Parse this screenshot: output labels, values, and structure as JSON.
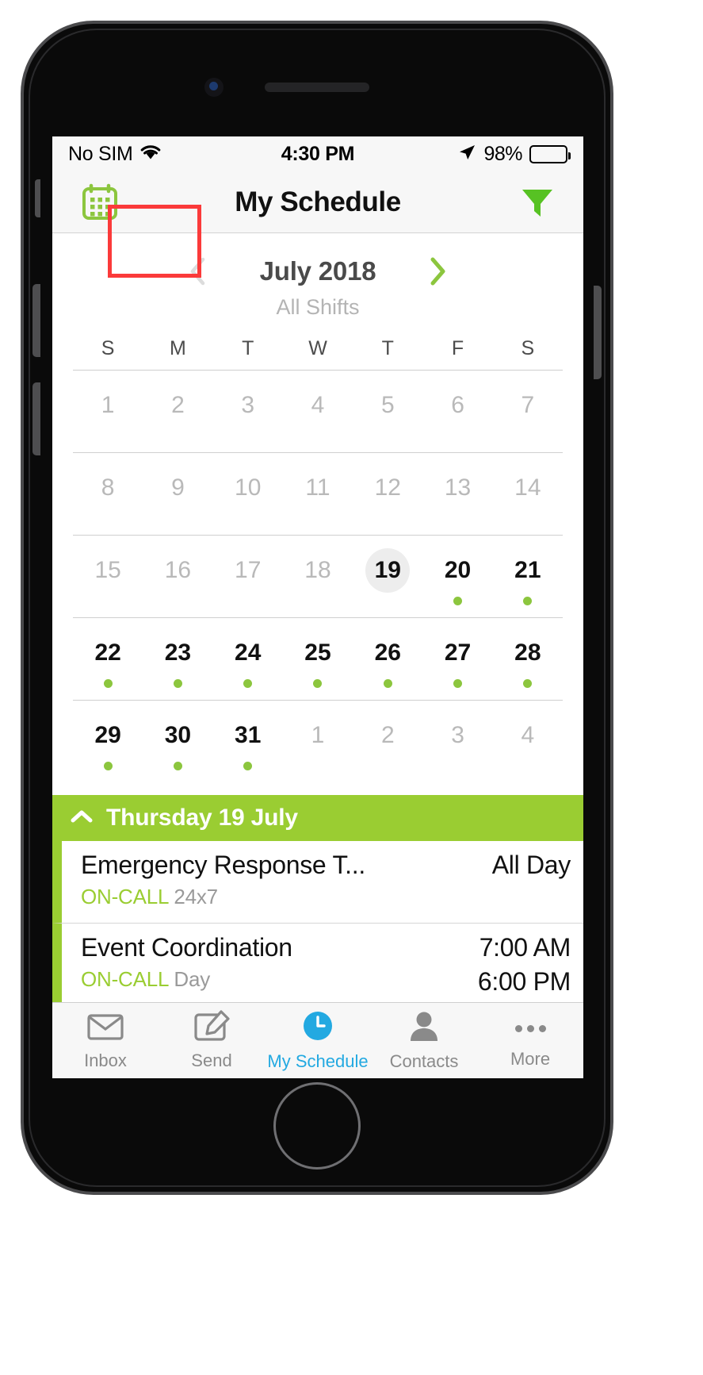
{
  "status_bar": {
    "carrier": "No SIM",
    "wifi_icon": "wifi-icon",
    "time": "4:30 PM",
    "location_icon": "location-arrow-icon",
    "battery_percent": "98%",
    "battery_icon": "battery-icon"
  },
  "nav_bar": {
    "left_icon": "calendar-icon",
    "title": "My Schedule",
    "right_icon": "filter-funnel-icon"
  },
  "highlight": {
    "color": "#fb3a3a",
    "target": "calendar-icon"
  },
  "month_header": {
    "prev_icon": "chevron-left-icon",
    "month": "July 2018",
    "next_icon": "chevron-right-icon",
    "shift_filter": "All Shifts"
  },
  "calendar": {
    "day_headers": [
      "S",
      "M",
      "T",
      "W",
      "T",
      "F",
      "S"
    ],
    "accent_dot_color": "#8cc63e",
    "today_highlight_color": "#ededed",
    "weeks": [
      [
        {
          "label": "1",
          "muted": true,
          "dot": false,
          "today": false
        },
        {
          "label": "2",
          "muted": true,
          "dot": false,
          "today": false
        },
        {
          "label": "3",
          "muted": true,
          "dot": false,
          "today": false
        },
        {
          "label": "4",
          "muted": true,
          "dot": false,
          "today": false
        },
        {
          "label": "5",
          "muted": true,
          "dot": false,
          "today": false
        },
        {
          "label": "6",
          "muted": true,
          "dot": false,
          "today": false
        },
        {
          "label": "7",
          "muted": true,
          "dot": false,
          "today": false
        }
      ],
      [
        {
          "label": "8",
          "muted": true,
          "dot": false,
          "today": false
        },
        {
          "label": "9",
          "muted": true,
          "dot": false,
          "today": false
        },
        {
          "label": "10",
          "muted": true,
          "dot": false,
          "today": false
        },
        {
          "label": "11",
          "muted": true,
          "dot": false,
          "today": false
        },
        {
          "label": "12",
          "muted": true,
          "dot": false,
          "today": false
        },
        {
          "label": "13",
          "muted": true,
          "dot": false,
          "today": false
        },
        {
          "label": "14",
          "muted": true,
          "dot": false,
          "today": false
        }
      ],
      [
        {
          "label": "15",
          "muted": true,
          "dot": false,
          "today": false
        },
        {
          "label": "16",
          "muted": true,
          "dot": false,
          "today": false
        },
        {
          "label": "17",
          "muted": true,
          "dot": false,
          "today": false
        },
        {
          "label": "18",
          "muted": true,
          "dot": false,
          "today": false
        },
        {
          "label": "19",
          "muted": false,
          "dot": false,
          "today": true
        },
        {
          "label": "20",
          "muted": false,
          "dot": true,
          "today": false
        },
        {
          "label": "21",
          "muted": false,
          "dot": true,
          "today": false
        }
      ],
      [
        {
          "label": "22",
          "muted": false,
          "dot": true,
          "today": false
        },
        {
          "label": "23",
          "muted": false,
          "dot": true,
          "today": false
        },
        {
          "label": "24",
          "muted": false,
          "dot": true,
          "today": false
        },
        {
          "label": "25",
          "muted": false,
          "dot": true,
          "today": false
        },
        {
          "label": "26",
          "muted": false,
          "dot": true,
          "today": false
        },
        {
          "label": "27",
          "muted": false,
          "dot": true,
          "today": false
        },
        {
          "label": "28",
          "muted": false,
          "dot": true,
          "today": false
        }
      ],
      [
        {
          "label": "29",
          "muted": false,
          "dot": true,
          "today": false
        },
        {
          "label": "30",
          "muted": false,
          "dot": true,
          "today": false
        },
        {
          "label": "31",
          "muted": false,
          "dot": true,
          "today": false
        },
        {
          "label": "1",
          "muted": true,
          "dot": false,
          "today": false
        },
        {
          "label": "2",
          "muted": true,
          "dot": false,
          "today": false
        },
        {
          "label": "3",
          "muted": true,
          "dot": false,
          "today": false
        },
        {
          "label": "4",
          "muted": true,
          "dot": false,
          "today": false
        }
      ]
    ]
  },
  "agenda": {
    "header": {
      "collapse_icon": "chevron-up-icon",
      "date_label": "Thursday 19 July",
      "background_color": "#9acd32"
    },
    "events": [
      {
        "title": "Emergency Response T...",
        "tag": "ON-CALL",
        "detail": "24x7",
        "time_start": "All Day",
        "time_end": ""
      },
      {
        "title": "Event Coordination",
        "tag": "ON-CALL",
        "detail": "Day",
        "time_start": "7:00 AM",
        "time_end": "6:00 PM"
      }
    ]
  },
  "tab_bar": {
    "tabs": [
      {
        "label": "Inbox",
        "icon": "envelope-icon",
        "active": false
      },
      {
        "label": "Send",
        "icon": "compose-pencil-icon",
        "active": false
      },
      {
        "label": "My Schedule",
        "icon": "clock-icon",
        "active": true
      },
      {
        "label": "Contacts",
        "icon": "person-icon",
        "active": false
      },
      {
        "label": "More",
        "icon": "ellipsis-icon",
        "active": false
      }
    ],
    "active_color": "#23a9e1",
    "inactive_color": "#8a8a8a"
  }
}
